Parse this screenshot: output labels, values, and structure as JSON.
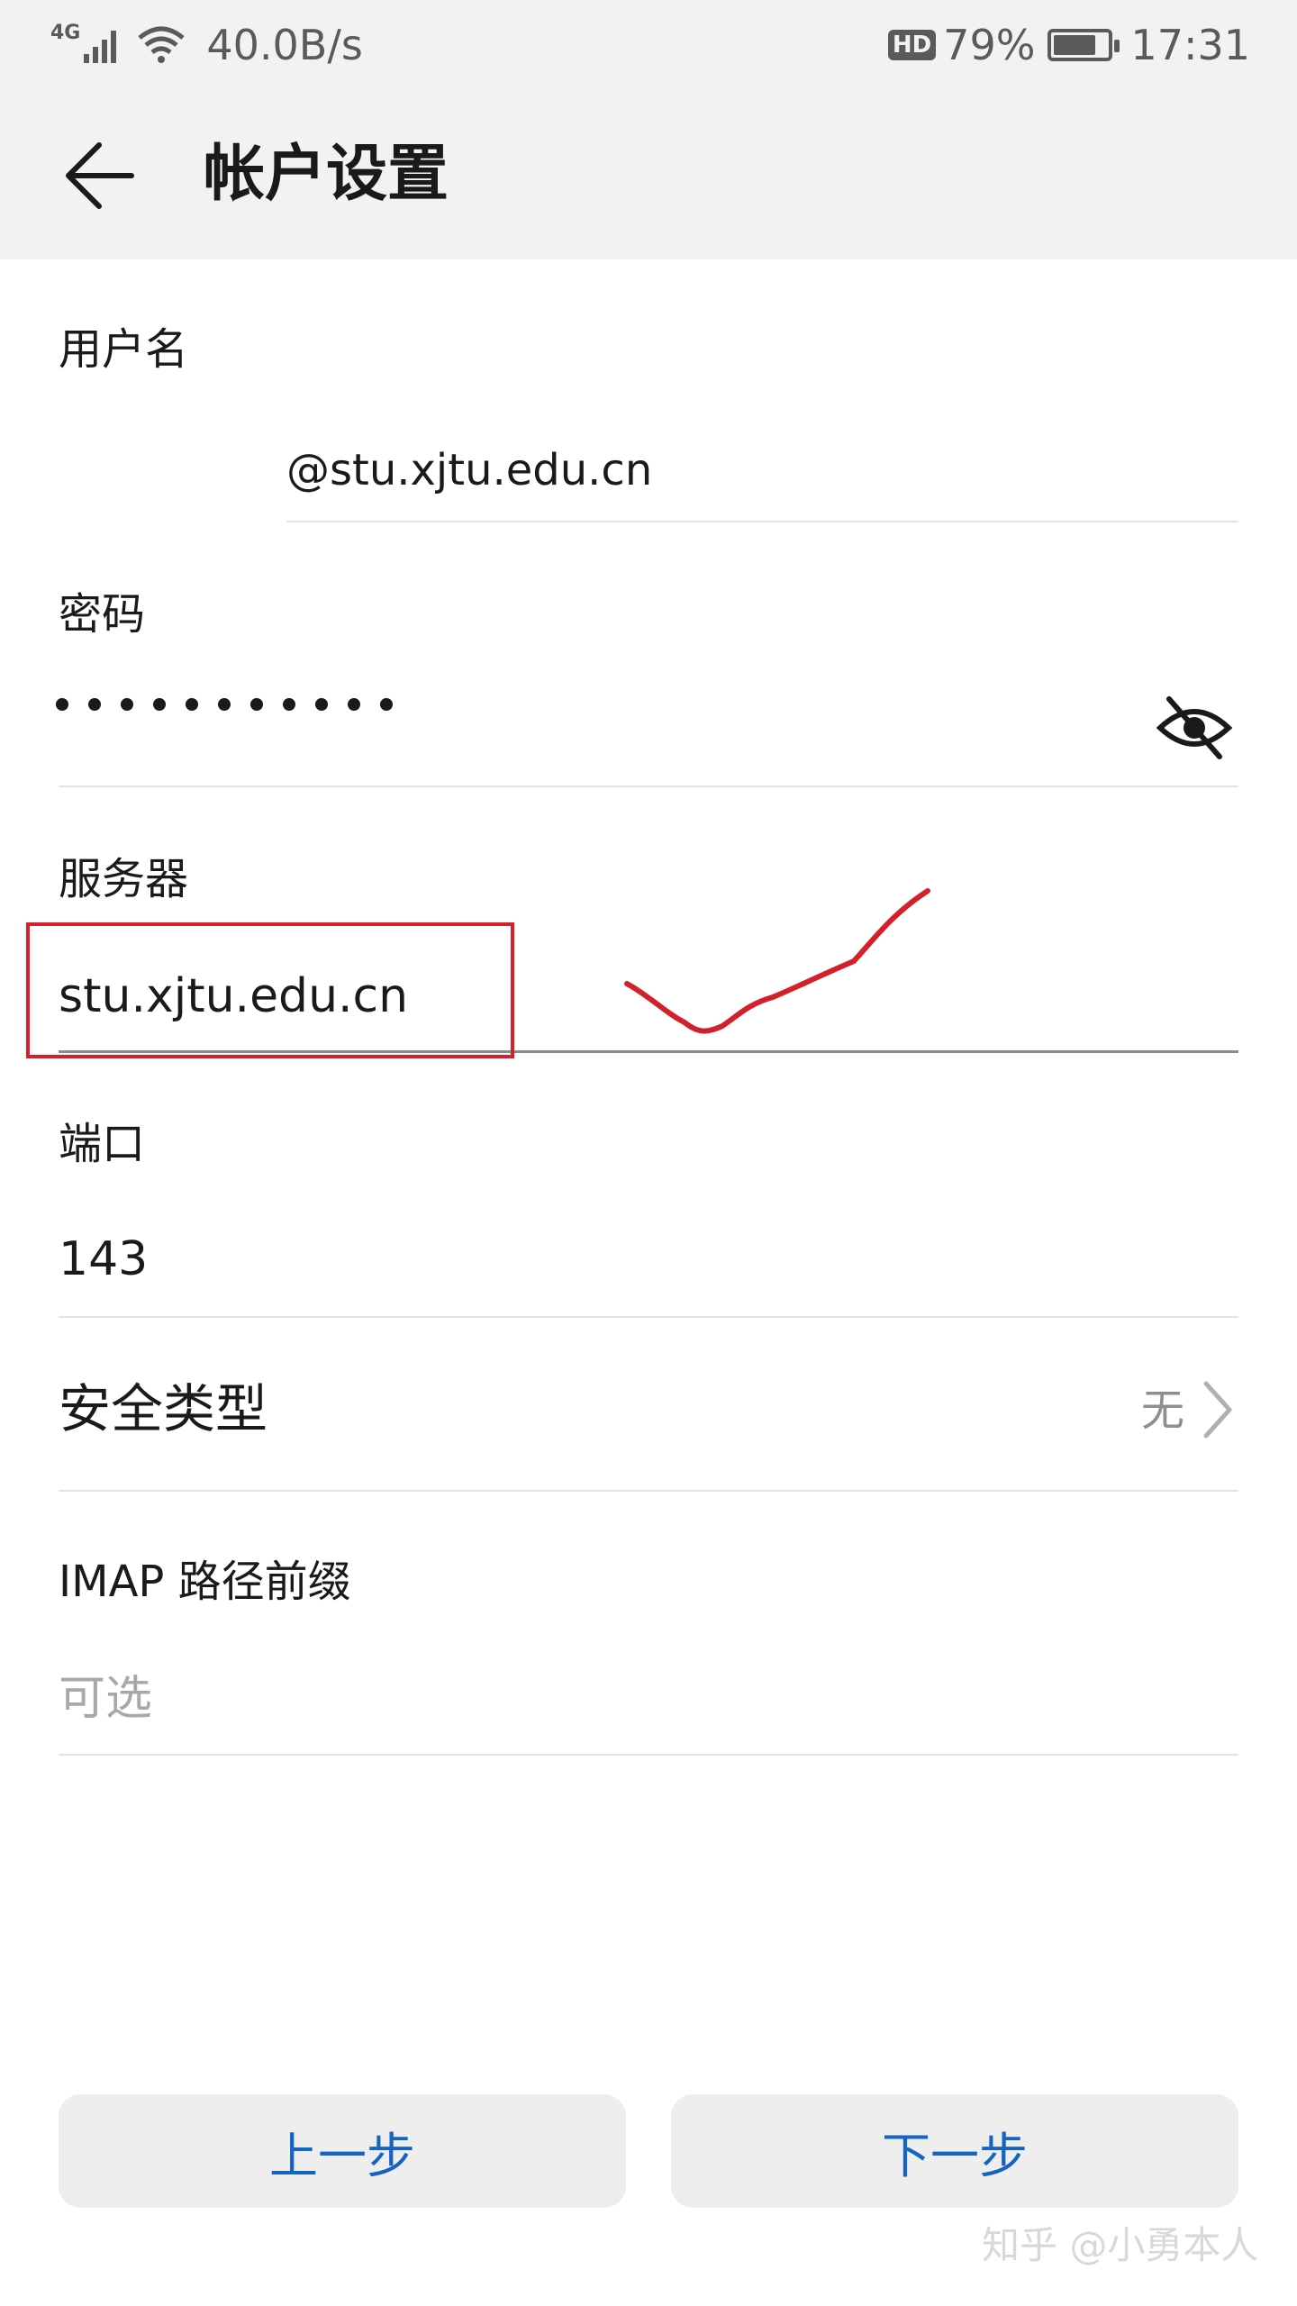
{
  "status_bar": {
    "network": "4G",
    "speed": "40.0B/s",
    "hd": "HD",
    "battery_pct": "79%",
    "battery_level": 0.79,
    "time": "17:31",
    "icons": [
      "signal-icon",
      "wifi-icon",
      "battery-icon"
    ]
  },
  "toolbar": {
    "back_icon": "back-arrow-icon",
    "title": "帐户设置"
  },
  "form": {
    "username": {
      "label": "用户名",
      "value": "@stu.xjtu.edu.cn"
    },
    "password": {
      "label": "密码",
      "masked_count": 11,
      "toggle_icon": "eye-off-icon"
    },
    "server": {
      "label": "服务器",
      "value": "stu.xjtu.edu.cn"
    },
    "port": {
      "label": "端口",
      "value": "143"
    },
    "security": {
      "label": "安全类型",
      "value": "无",
      "icon": "chevron-right-icon"
    },
    "imap_prefix": {
      "label": "IMAP 路径前缀",
      "placeholder": "可选"
    }
  },
  "buttons": {
    "prev": "上一步",
    "next": "下一步"
  },
  "annotations": {
    "highlight_color": "#d4202b"
  },
  "watermark": "知乎 @小勇本人",
  "colors": {
    "accent": "#1565c0",
    "toolbar_bg": "#f2f2f2",
    "button_bg": "#eeeeee"
  }
}
